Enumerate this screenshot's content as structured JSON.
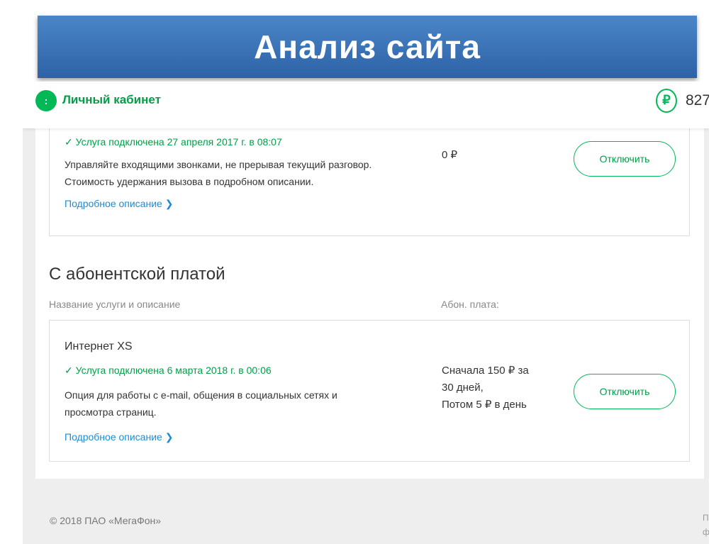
{
  "slide": {
    "title": "Анализ сайта"
  },
  "header": {
    "logo_glyph": ":",
    "brand": "Личный кабинет",
    "currency_symbol": "₽",
    "balance": "827,"
  },
  "cards": [
    {
      "status": "✓ Услуга подключена 27 апреля 2017 г. в 08:07",
      "description": [
        "Управляйте входящими звонками, не прерывая текущий разговор.",
        "Стоимость удержания вызова в подробном описании."
      ],
      "more": "Подробное описание ❯",
      "price": [
        "0 ₽"
      ],
      "button": "Отключить"
    },
    {
      "name": "Интернет XS",
      "status": "✓ Услуга подключена 6 марта 2018 г. в 00:06",
      "description": [
        "Опция для работы с e-mail, общения в социальных сетях и",
        "просмотра страниц."
      ],
      "more": "Подробное описание ❯",
      "price": [
        "Сначала 150 ₽ за",
        "30 дней,",
        "Потом 5 ₽ в день"
      ],
      "button": "Отключить"
    }
  ],
  "section": {
    "title": "С абонентской платой",
    "col_name": "Название услуги и описание",
    "col_fee": "Абон. плата:"
  },
  "footer": {
    "copyright": "© 2018 ПАО «МегаФон»",
    "side": [
      "П",
      "ф"
    ]
  },
  "colors": {
    "brand": "#00b956",
    "link": "#1a8cd8",
    "banner": "#3a73b8"
  }
}
